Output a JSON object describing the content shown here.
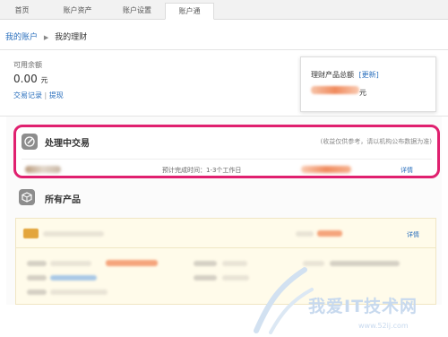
{
  "tabs": [
    {
      "label": "首页",
      "active": false
    },
    {
      "label": "账户资产",
      "active": false
    },
    {
      "label": "账户设置",
      "active": false
    },
    {
      "label": "账户通",
      "active": true
    }
  ],
  "breadcrumb": {
    "root": "我的账户",
    "separator": "▶",
    "current": "我的理财"
  },
  "balance": {
    "label": "可用余额",
    "value": "0.00",
    "unit": "元",
    "links": {
      "records": "交易记录",
      "separator": "|",
      "withdraw": "提现"
    }
  },
  "total_box": {
    "title": "理财产品总额",
    "refresh": "[更新]",
    "unit": "元"
  },
  "processing": {
    "title": "处理中交易",
    "note": "(收益仅供参考，请以机构公布数据为准)",
    "row": {
      "time": "预计完成时间：1-3个工作日",
      "detail": "详情"
    }
  },
  "all_products": {
    "title": "所有产品",
    "row_detail": "详情"
  },
  "watermark": {
    "text": "我爱IT技术网",
    "url": "www.52ij.com"
  },
  "colors": {
    "link": "#2a6fbd",
    "highlight_border": "#e0206f",
    "amount_blur": "#f08a5d",
    "product_bg": "#fffbea"
  }
}
